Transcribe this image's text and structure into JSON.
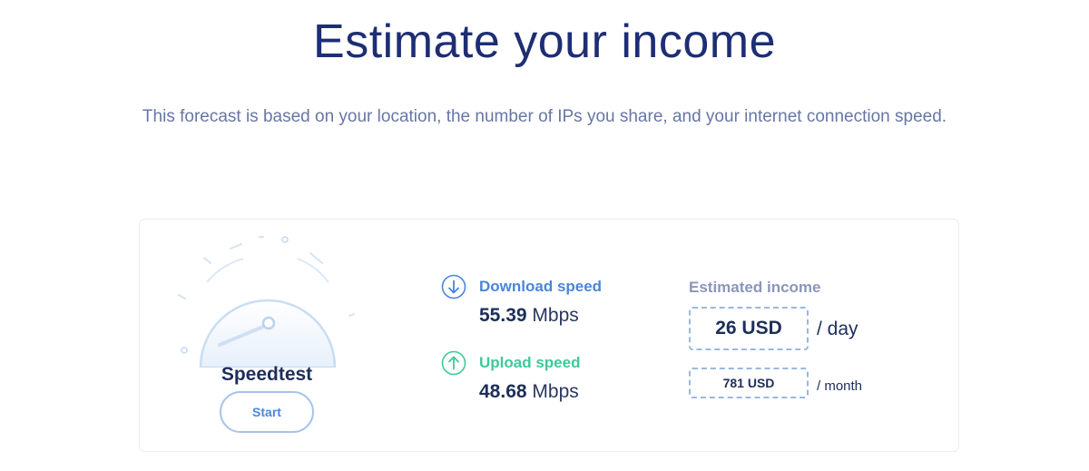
{
  "header": {
    "title": "Estimate your income",
    "subtitle": "This forecast is based on your location, the number of IPs you share, and your internet connection speed."
  },
  "speedtest": {
    "label": "Speedtest",
    "start_label": "Start",
    "gauge_icon": "speedometer-icon"
  },
  "download": {
    "icon": "arrow-down-icon",
    "label": "Download speed",
    "value": "55.39",
    "unit": "Mbps",
    "color": "#4a86d8"
  },
  "upload": {
    "icon": "arrow-up-icon",
    "label": "Upload speed",
    "value": "48.68",
    "unit": "Mbps",
    "color": "#3ec99a"
  },
  "income": {
    "label": "Estimated income",
    "daily_value": "26 USD",
    "daily_period": "/ day",
    "monthly_value": "781 USD",
    "monthly_period": "/ month"
  },
  "colors": {
    "title": "#1d2e74",
    "subtitle": "#6776a6",
    "gauge_stroke": "#c9ddf3"
  }
}
